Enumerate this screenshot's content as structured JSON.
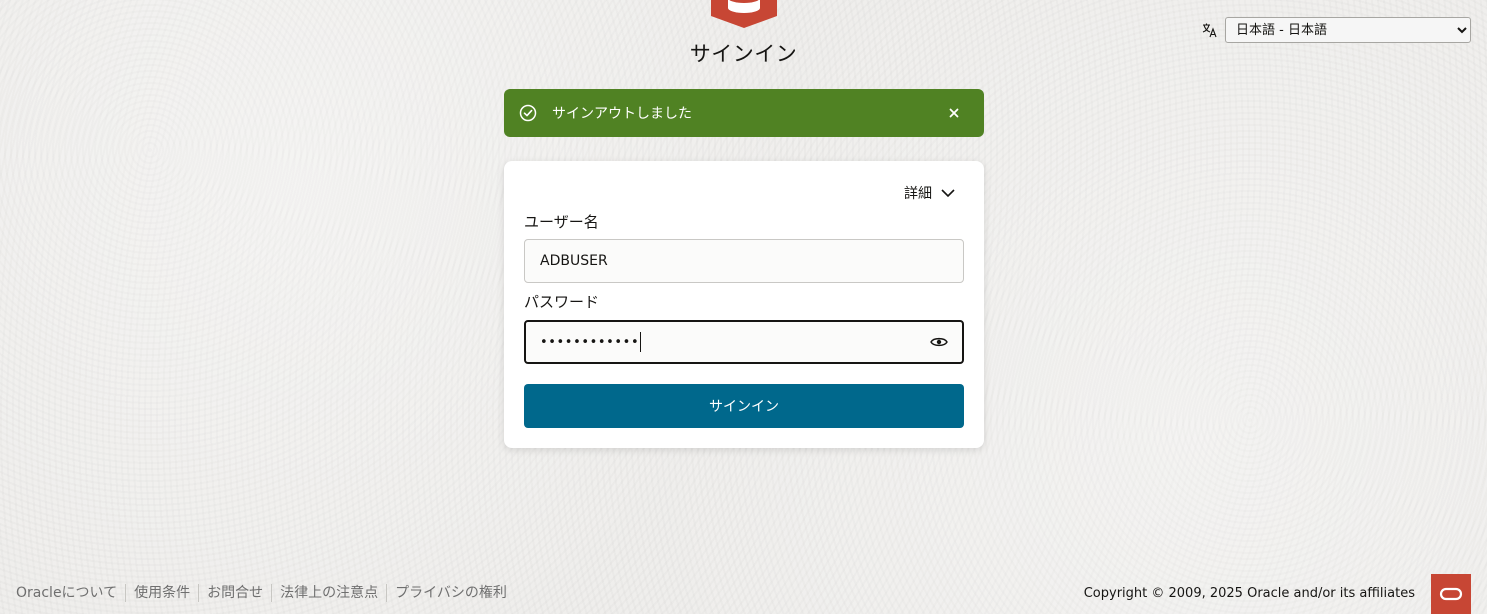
{
  "page": {
    "title": "サインイン"
  },
  "language": {
    "selected": "日本語 - 日本語",
    "icon": "translate-icon"
  },
  "banner": {
    "message": "サインアウトしました",
    "icon": "check-circle-icon",
    "close_label": "×",
    "color": "#508223"
  },
  "form": {
    "details_label": "詳細",
    "username_label": "ユーザー名",
    "username_value": "ADBUSER",
    "password_label": "パスワード",
    "password_masked": "••••••••••••",
    "submit_label": "サインイン"
  },
  "footer": {
    "links": [
      "Oracleについて",
      "使用条件",
      "お問合せ",
      "法律上の注意点",
      "プライバシの権利"
    ],
    "copyright": "Copyright © 2009, 2025 Oracle and/or its affiliates"
  },
  "colors": {
    "brand": "#c74634",
    "primary_button": "#00688c",
    "success": "#508223"
  }
}
